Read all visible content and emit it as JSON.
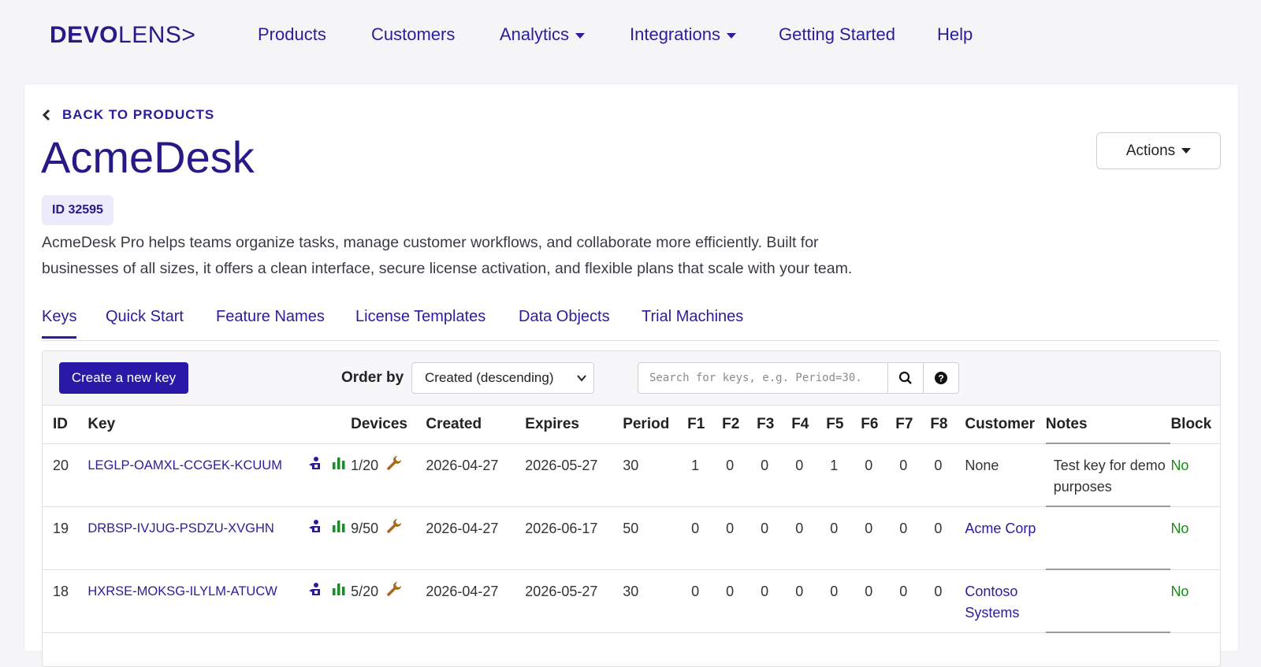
{
  "brand": {
    "bold": "DEVO",
    "thin": "LENS>"
  },
  "nav": {
    "products": "Products",
    "customers": "Customers",
    "analytics": "Analytics",
    "integrations": "Integrations",
    "getting_started": "Getting Started",
    "help": "Help"
  },
  "page": {
    "back_label": "BACK TO PRODUCTS",
    "title": "AcmeDesk",
    "actions_label": "Actions",
    "id_badge": "ID 32595",
    "description": "AcmeDesk Pro helps teams organize tasks, manage customer workflows, and collaborate more efficiently. Built for businesses of all sizes, it offers a clean interface, secure license activation, and flexible plans that scale with your team."
  },
  "tabs": [
    "Keys",
    "Quick Start",
    "Feature Names",
    "License Templates",
    "Data Objects",
    "Trial Machines"
  ],
  "toolbar": {
    "create_label": "Create a new key",
    "order_label": "Order by",
    "order_value": "Created (descending)",
    "search_placeholder": "Search for keys, e.g. Period=30."
  },
  "columns": [
    "ID",
    "Key",
    "Devices",
    "Created",
    "Expires",
    "Period",
    "F1",
    "F2",
    "F3",
    "F4",
    "F5",
    "F6",
    "F7",
    "F8",
    "Customer",
    "Notes",
    "Block"
  ],
  "rows": [
    {
      "id": "20",
      "key": "LEGLP-OAMXL-CCGEK-KCUUM",
      "devices": "1/20",
      "created": "2026-04-27",
      "expires": "2026-05-27",
      "period": "30",
      "f": [
        "1",
        "0",
        "0",
        "0",
        "1",
        "0",
        "0",
        "0"
      ],
      "customer": "None",
      "customer_link": false,
      "notes": "Test key for demo purposes",
      "block": "No"
    },
    {
      "id": "19",
      "key": "DRBSP-IVJUG-PSDZU-XVGHN",
      "devices": "9/50",
      "created": "2026-04-27",
      "expires": "2026-06-17",
      "period": "50",
      "f": [
        "0",
        "0",
        "0",
        "0",
        "0",
        "0",
        "0",
        "0"
      ],
      "customer": "Acme Corp",
      "customer_link": true,
      "notes": "",
      "block": "No"
    },
    {
      "id": "18",
      "key": "HXRSE-MOKSG-ILYLM-ATUCW",
      "devices": "5/20",
      "created": "2026-04-27",
      "expires": "2026-05-27",
      "period": "30",
      "f": [
        "0",
        "0",
        "0",
        "0",
        "0",
        "0",
        "0",
        "0"
      ],
      "customer": "Contoso Systems",
      "customer_link": true,
      "notes": "",
      "block": "No"
    }
  ],
  "colors": {
    "brand": "#261b86",
    "link": "#2a1d9c",
    "button": "#2a18a8",
    "success": "#1a8a1a",
    "tool_icon": "#a86a1a",
    "chart_icon": "#1e8a2a"
  },
  "icons": {
    "row": [
      "activation-icon",
      "bar-chart-icon",
      "wrench-icon"
    ],
    "search": "search-icon",
    "help": "question-circle-icon"
  }
}
